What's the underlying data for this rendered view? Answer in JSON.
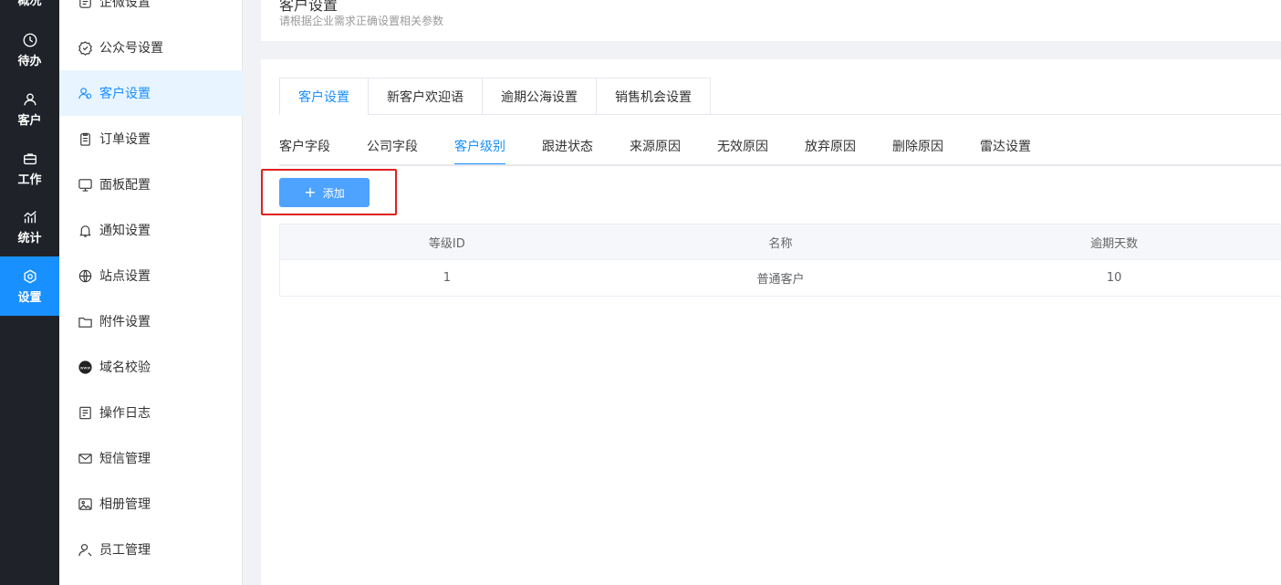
{
  "rail": {
    "items": [
      {
        "label": "概况",
        "icon": "overview-icon"
      },
      {
        "label": "待办",
        "icon": "clock-icon"
      },
      {
        "label": "客户",
        "icon": "user-icon"
      },
      {
        "label": "工作",
        "icon": "briefcase-icon"
      },
      {
        "label": "统计",
        "icon": "chart-icon"
      },
      {
        "label": "设置",
        "icon": "gear-icon"
      }
    ],
    "active_label": "设置"
  },
  "sidebar": {
    "items": [
      {
        "label": "企微设置",
        "icon": "wecom-icon"
      },
      {
        "label": "公众号设置",
        "icon": "badge-check-icon"
      },
      {
        "label": "客户设置",
        "icon": "users-icon"
      },
      {
        "label": "订单设置",
        "icon": "clipboard-icon"
      },
      {
        "label": "面板配置",
        "icon": "monitor-icon"
      },
      {
        "label": "通知设置",
        "icon": "bell-icon"
      },
      {
        "label": "站点设置",
        "icon": "globe-icon"
      },
      {
        "label": "附件设置",
        "icon": "folder-icon"
      },
      {
        "label": "域名校验",
        "icon": "www-icon"
      },
      {
        "label": "操作日志",
        "icon": "log-icon"
      },
      {
        "label": "短信管理",
        "icon": "mail-icon"
      },
      {
        "label": "相册管理",
        "icon": "image-icon"
      },
      {
        "label": "员工管理",
        "icon": "user-gear-icon"
      }
    ],
    "active_label": "客户设置"
  },
  "header": {
    "title": "客户设置",
    "subtitle": "请根据企业需求正确设置相关参数"
  },
  "tabs": [
    "客户设置",
    "新客户欢迎语",
    "逾期公海设置",
    "销售机会设置"
  ],
  "active_tab": "客户设置",
  "subtabs": [
    "客户字段",
    "公司字段",
    "客户级别",
    "跟进状态",
    "来源原因",
    "无效原因",
    "放弃原因",
    "删除原因",
    "雷达设置"
  ],
  "active_subtab": "客户级别",
  "add_button": {
    "label": "添加"
  },
  "table": {
    "columns": [
      "等级ID",
      "名称",
      "逾期天数"
    ],
    "rows": [
      [
        "1",
        "普通客户",
        "10"
      ]
    ]
  },
  "colors": {
    "accent": "#1890ff",
    "rail_bg": "#1f2329",
    "highlight": "#e02020"
  }
}
